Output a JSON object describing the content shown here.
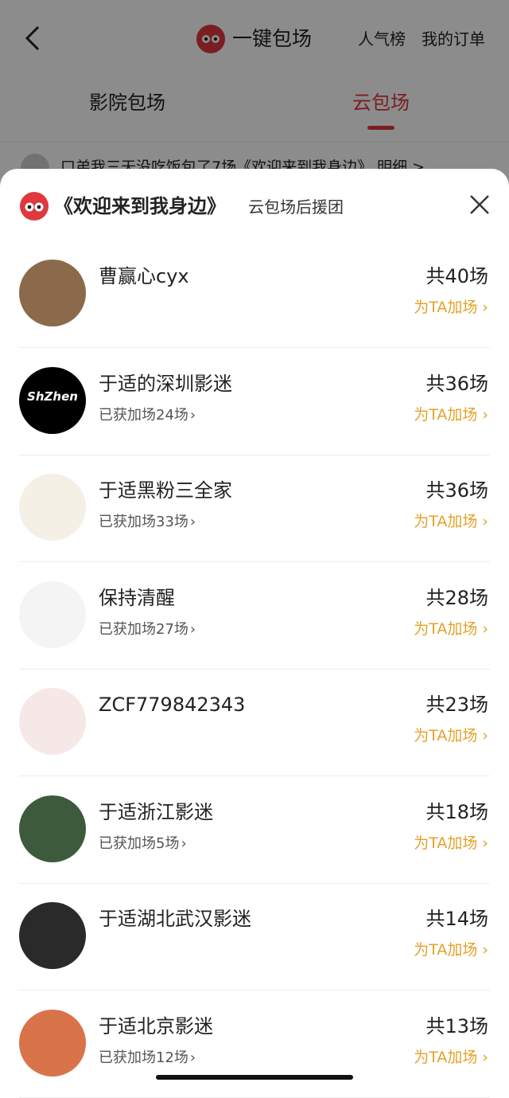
{
  "nav": {
    "title": "一键包场",
    "link_rank": "人气榜",
    "link_orders": "我的订单"
  },
  "tabs": [
    {
      "label": "影院包场",
      "active": false
    },
    {
      "label": "云包场",
      "active": true
    }
  ],
  "ticker": {
    "text": "口弟我三天没吃饭包了7场《欢迎来到我身边》 明细 >"
  },
  "sheet": {
    "movie_title": "《欢迎来到我身边》",
    "subtitle": "云包场后援团",
    "close_icon": "close-icon"
  },
  "add_label": "为TA加场",
  "colors": {
    "accent_red": "#e0383e",
    "gold": "#e3a228"
  },
  "rows": [
    {
      "name": "曹赢心cyx",
      "gained": "",
      "count": "共40场",
      "avatar_color": "#8a6a4a"
    },
    {
      "name": "于适的深圳影迷",
      "gained": "已获加场24场",
      "count": "共36场",
      "avatar_color": "#000000",
      "avatar_text": "ShZhen"
    },
    {
      "name": "于适黑粉三全家",
      "gained": "已获加场33场",
      "count": "共36场",
      "avatar_color": "#f5f0e6"
    },
    {
      "name": "保持清醒",
      "gained": "已获加场27场",
      "count": "共28场",
      "avatar_color": "#f4f4f4"
    },
    {
      "name": "ZCF779842343",
      "gained": "",
      "count": "共23场",
      "avatar_color": "#f7e8e8"
    },
    {
      "name": "于适浙江影迷",
      "gained": "已获加场5场",
      "count": "共18场",
      "avatar_color": "#3d5a3d"
    },
    {
      "name": "于适湖北武汉影迷",
      "gained": "",
      "count": "共14场",
      "avatar_color": "#2a2a2a"
    },
    {
      "name": "于适北京影迷",
      "gained": "已获加场12场",
      "count": "共13场",
      "avatar_color": "#d9734a"
    }
  ]
}
